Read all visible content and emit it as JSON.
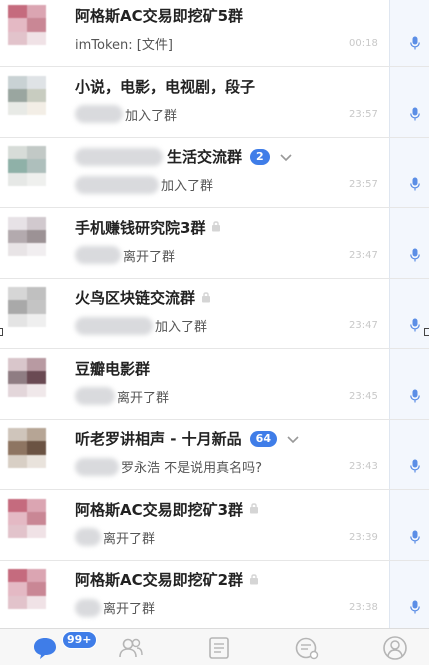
{
  "colors": {
    "accent": "#3f7de8",
    "time": "#c8c8c8",
    "title": "#222222",
    "subtitle": "#555555"
  },
  "chats": [
    {
      "title": "阿格斯AC交易即挖矿5群",
      "subtitle": "imToken: [文件]",
      "time": "00:18",
      "avatar_colors": [
        "#c56b7e",
        "#dba5b2",
        "#e4b9c4",
        "#c98795",
        "#e2c3cb",
        "#f0e2e6"
      ]
    },
    {
      "title": "小说，电影，电视剧，段子",
      "subtitle": "加入了群",
      "time": "23:57",
      "avatar_colors": [
        "#c9d2d4",
        "#dfe3e6",
        "#9aa6a0",
        "#c8ccc0",
        "#e8eae6",
        "#f3eee6"
      ]
    },
    {
      "title": "生活交流群",
      "badge": "2",
      "subtitle": "加入了群",
      "time": "23:57",
      "avatar_colors": [
        "#d7dcd8",
        "#c2c9c6",
        "#8fb1a8",
        "#aebfbc",
        "#e6e8e6",
        "#eff0ee"
      ]
    },
    {
      "title": "手机赚钱研究院3群",
      "subtitle": "离开了群",
      "time": "23:47",
      "avatar_colors": [
        "#e7e2e6",
        "#d1c9ce",
        "#b3aaae",
        "#9c9295",
        "#e8e4e6",
        "#f1eef0"
      ]
    },
    {
      "title": "火鸟区块链交流群",
      "subtitle": "加入了群",
      "time": "23:47",
      "avatar_colors": [
        "#d6d6d6",
        "#c0c0c0",
        "#a9a9a9",
        "#c4c4c4",
        "#e4e4e4",
        "#efefef"
      ]
    },
    {
      "title": "豆瓣电影群",
      "subtitle": "离开了群",
      "time": "23:45",
      "avatar_colors": [
        "#d9c6cb",
        "#b89aa2",
        "#8f7d83",
        "#6a4a53",
        "#e3d6da",
        "#f0e8ea"
      ]
    },
    {
      "title": "听老罗讲相声 - 十月新品",
      "badge": "64",
      "subtitle": "罗永浩 不是说用真名吗?",
      "time": "23:43",
      "avatar_colors": [
        "#cfc5bb",
        "#b6a595",
        "#8e7562",
        "#6b5343",
        "#d8cfc5",
        "#e9e3dc"
      ]
    },
    {
      "title": "阿格斯AC交易即挖矿3群",
      "subtitle": "离开了群",
      "time": "23:39",
      "avatar_colors": [
        "#c56b7e",
        "#dba5b2",
        "#e4b9c4",
        "#c98795",
        "#e2c3cb",
        "#f0e2e6"
      ]
    },
    {
      "title": "阿格斯AC交易即挖矿2群",
      "subtitle": "离开了群",
      "time": "23:38",
      "avatar_colors": [
        "#c56b7e",
        "#dba5b2",
        "#e4b9c4",
        "#c98795",
        "#e2c3cb",
        "#f0e2e6"
      ]
    }
  ],
  "tabbar": {
    "messages_badge": "99+",
    "icons": [
      "chat-bubble-icon",
      "contacts-icon",
      "notes-icon",
      "discover-icon",
      "profile-icon"
    ]
  }
}
